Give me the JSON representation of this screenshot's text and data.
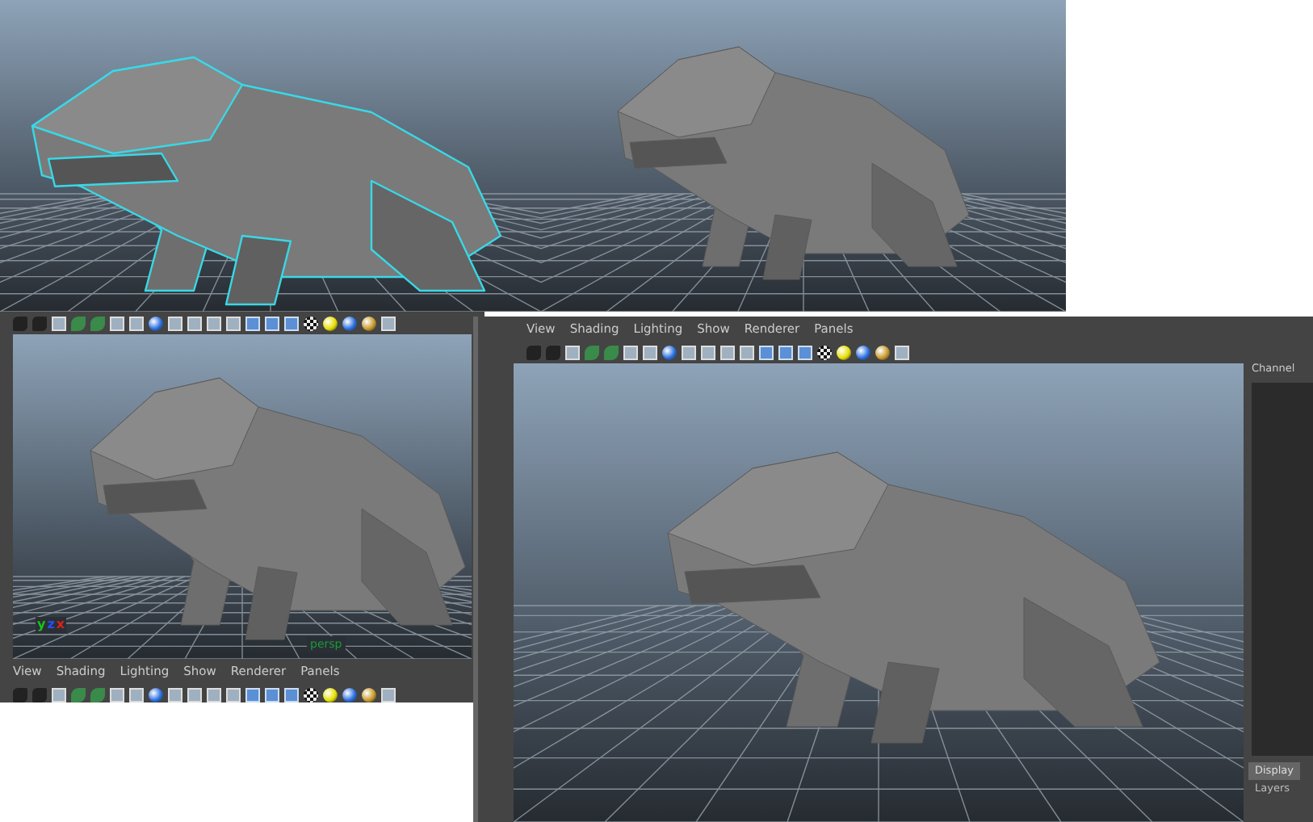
{
  "renders": [
    {
      "kind": "wireframe"
    },
    {
      "kind": "shaded"
    }
  ],
  "left_viewport": {
    "camera_label": "persp",
    "axis_labels": [
      {
        "text": "y",
        "color": "#19c419"
      },
      {
        "text": "z",
        "color": "#2a4cff"
      },
      {
        "text": "x",
        "color": "#e02020"
      }
    ],
    "menu": [
      "View",
      "Shading",
      "Lighting",
      "Show",
      "Renderer",
      "Panels"
    ]
  },
  "right_viewport": {
    "menu": [
      "View",
      "Shading",
      "Lighting",
      "Show",
      "Renderer",
      "Panels"
    ]
  },
  "channel_box": {
    "title": "Channel",
    "tabs": [
      {
        "label": "Display",
        "selected": true
      },
      {
        "label": "Layers",
        "selected": false
      }
    ]
  }
}
